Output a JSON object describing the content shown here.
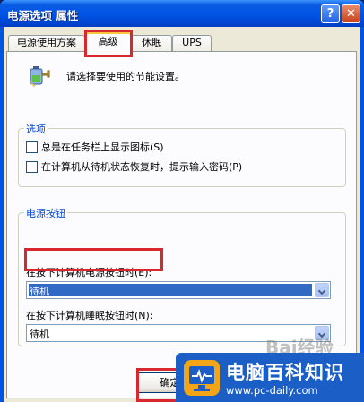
{
  "window": {
    "title": "电源选项 属性",
    "help_label": "?",
    "close_label": "✕"
  },
  "tabs": [
    {
      "label": "电源使用方案"
    },
    {
      "label": "高级"
    },
    {
      "label": "休眠"
    },
    {
      "label": "UPS"
    }
  ],
  "active_tab": "高级",
  "intro_text": "请选择要使用的节能设置。",
  "options_group": {
    "title": "选项",
    "checks": [
      {
        "label": "总是在任务栏上显示图标(S)",
        "checked": false
      },
      {
        "label": "在计算机从待机状态恢复时，提示输入密码(P)",
        "checked": false
      }
    ]
  },
  "power_buttons_group": {
    "title": "电源按钮",
    "power_button_label": "在按下计算机电源按钮时(E):",
    "power_button_value": "待机",
    "sleep_button_label": "在按下计算机睡眠按钮时(N):",
    "sleep_button_value": "待机"
  },
  "ok_label": "确定",
  "watermark": {
    "text": "Bai经验",
    "site_name": "电脑百科知识",
    "site_url": "www.pc-daily.com"
  },
  "colors": {
    "highlight": "#d8282d",
    "accent": "#0046d5",
    "banner": "#1b5fc6"
  },
  "icons": [
    "battery-plug-icon",
    "help-icon",
    "close-icon",
    "chevron-down-icon",
    "monitor-logo-icon"
  ]
}
